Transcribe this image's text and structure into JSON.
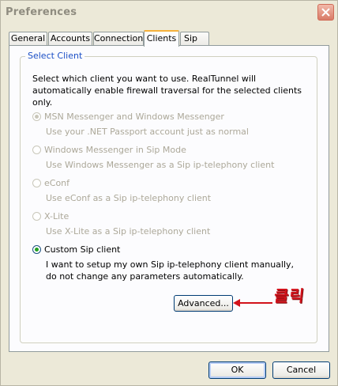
{
  "window": {
    "title": "Preferences"
  },
  "tabs": [
    {
      "label": "General"
    },
    {
      "label": "Accounts"
    },
    {
      "label": "Connection"
    },
    {
      "label": "Clients",
      "active": true
    },
    {
      "label": "Sip"
    }
  ],
  "group": {
    "title": "Select Client",
    "description": "Select which client you want to use. RealTunnel will automatically enable firewall traversal for the selected clients only."
  },
  "options": [
    {
      "label": "MSN Messenger and Windows Messenger",
      "sub": "Use your .NET Passport account just as normal",
      "enabled": false,
      "selected": true
    },
    {
      "label": "Windows Messenger in Sip Mode",
      "sub": "Use Windows Messenger as a Sip ip-telephony client",
      "enabled": false,
      "selected": false
    },
    {
      "label": "eConf",
      "sub": "Use eConf as a Sip ip-telephony client",
      "enabled": false,
      "selected": false
    },
    {
      "label": "X-Lite",
      "sub": "Use X-Lite as a Sip ip-telephony client",
      "enabled": false,
      "selected": false
    },
    {
      "label": "Custom Sip client",
      "sub": "I want to setup my own Sip ip-telephony client manually, do not change any parameters automatically.",
      "enabled": true,
      "selected": true
    }
  ],
  "buttons": {
    "advanced": "Advanced...",
    "ok": "OK",
    "cancel": "Cancel"
  },
  "annotation": {
    "text": "클릭",
    "color": "#d2121b"
  }
}
